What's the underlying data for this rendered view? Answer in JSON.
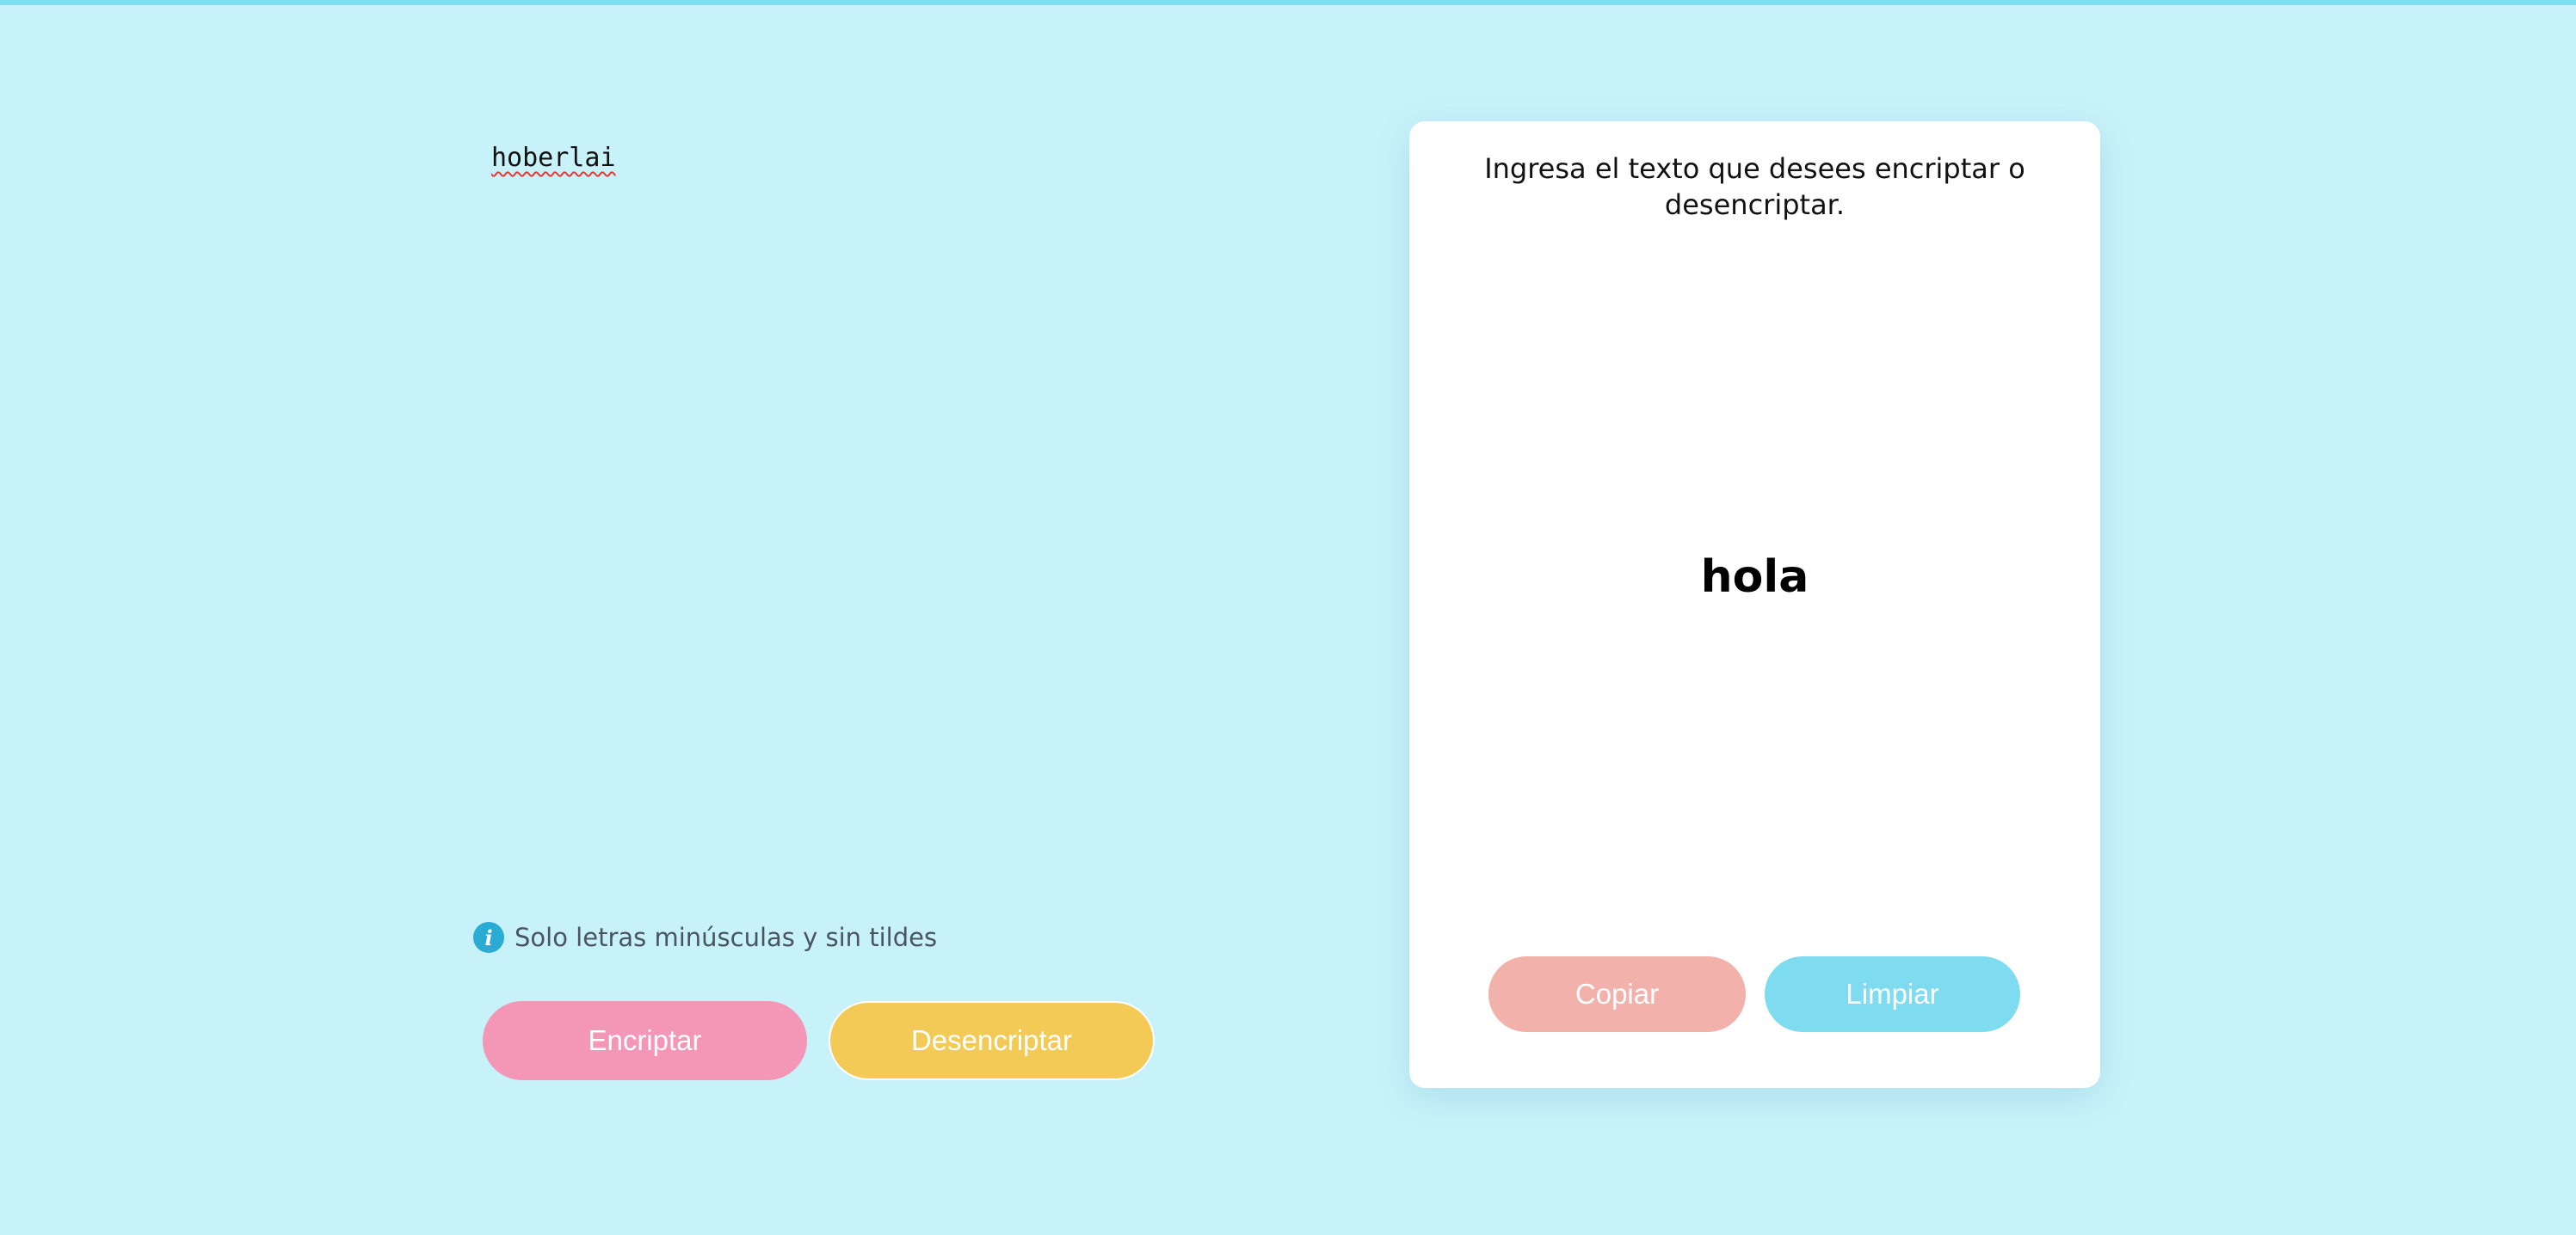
{
  "input": {
    "value": "hoberlai"
  },
  "hint": {
    "icon": "info-icon",
    "text": "Solo letras minúsculas y sin tildes"
  },
  "actions": {
    "encrypt_label": "Encriptar",
    "decrypt_label": "Desencriptar"
  },
  "output": {
    "instructions": "Ingresa el texto que desees encriptar o desencriptar.",
    "result": "hola",
    "copy_label": "Copiar",
    "clear_label": "Limpiar"
  },
  "colors": {
    "background": "#c8f2fa",
    "encrypt_button": "#f496b5",
    "decrypt_button": "#f2ca55",
    "copy_button": "#f2b1ab",
    "clear_button": "#7fdbef",
    "info_icon": "#29abd3"
  }
}
